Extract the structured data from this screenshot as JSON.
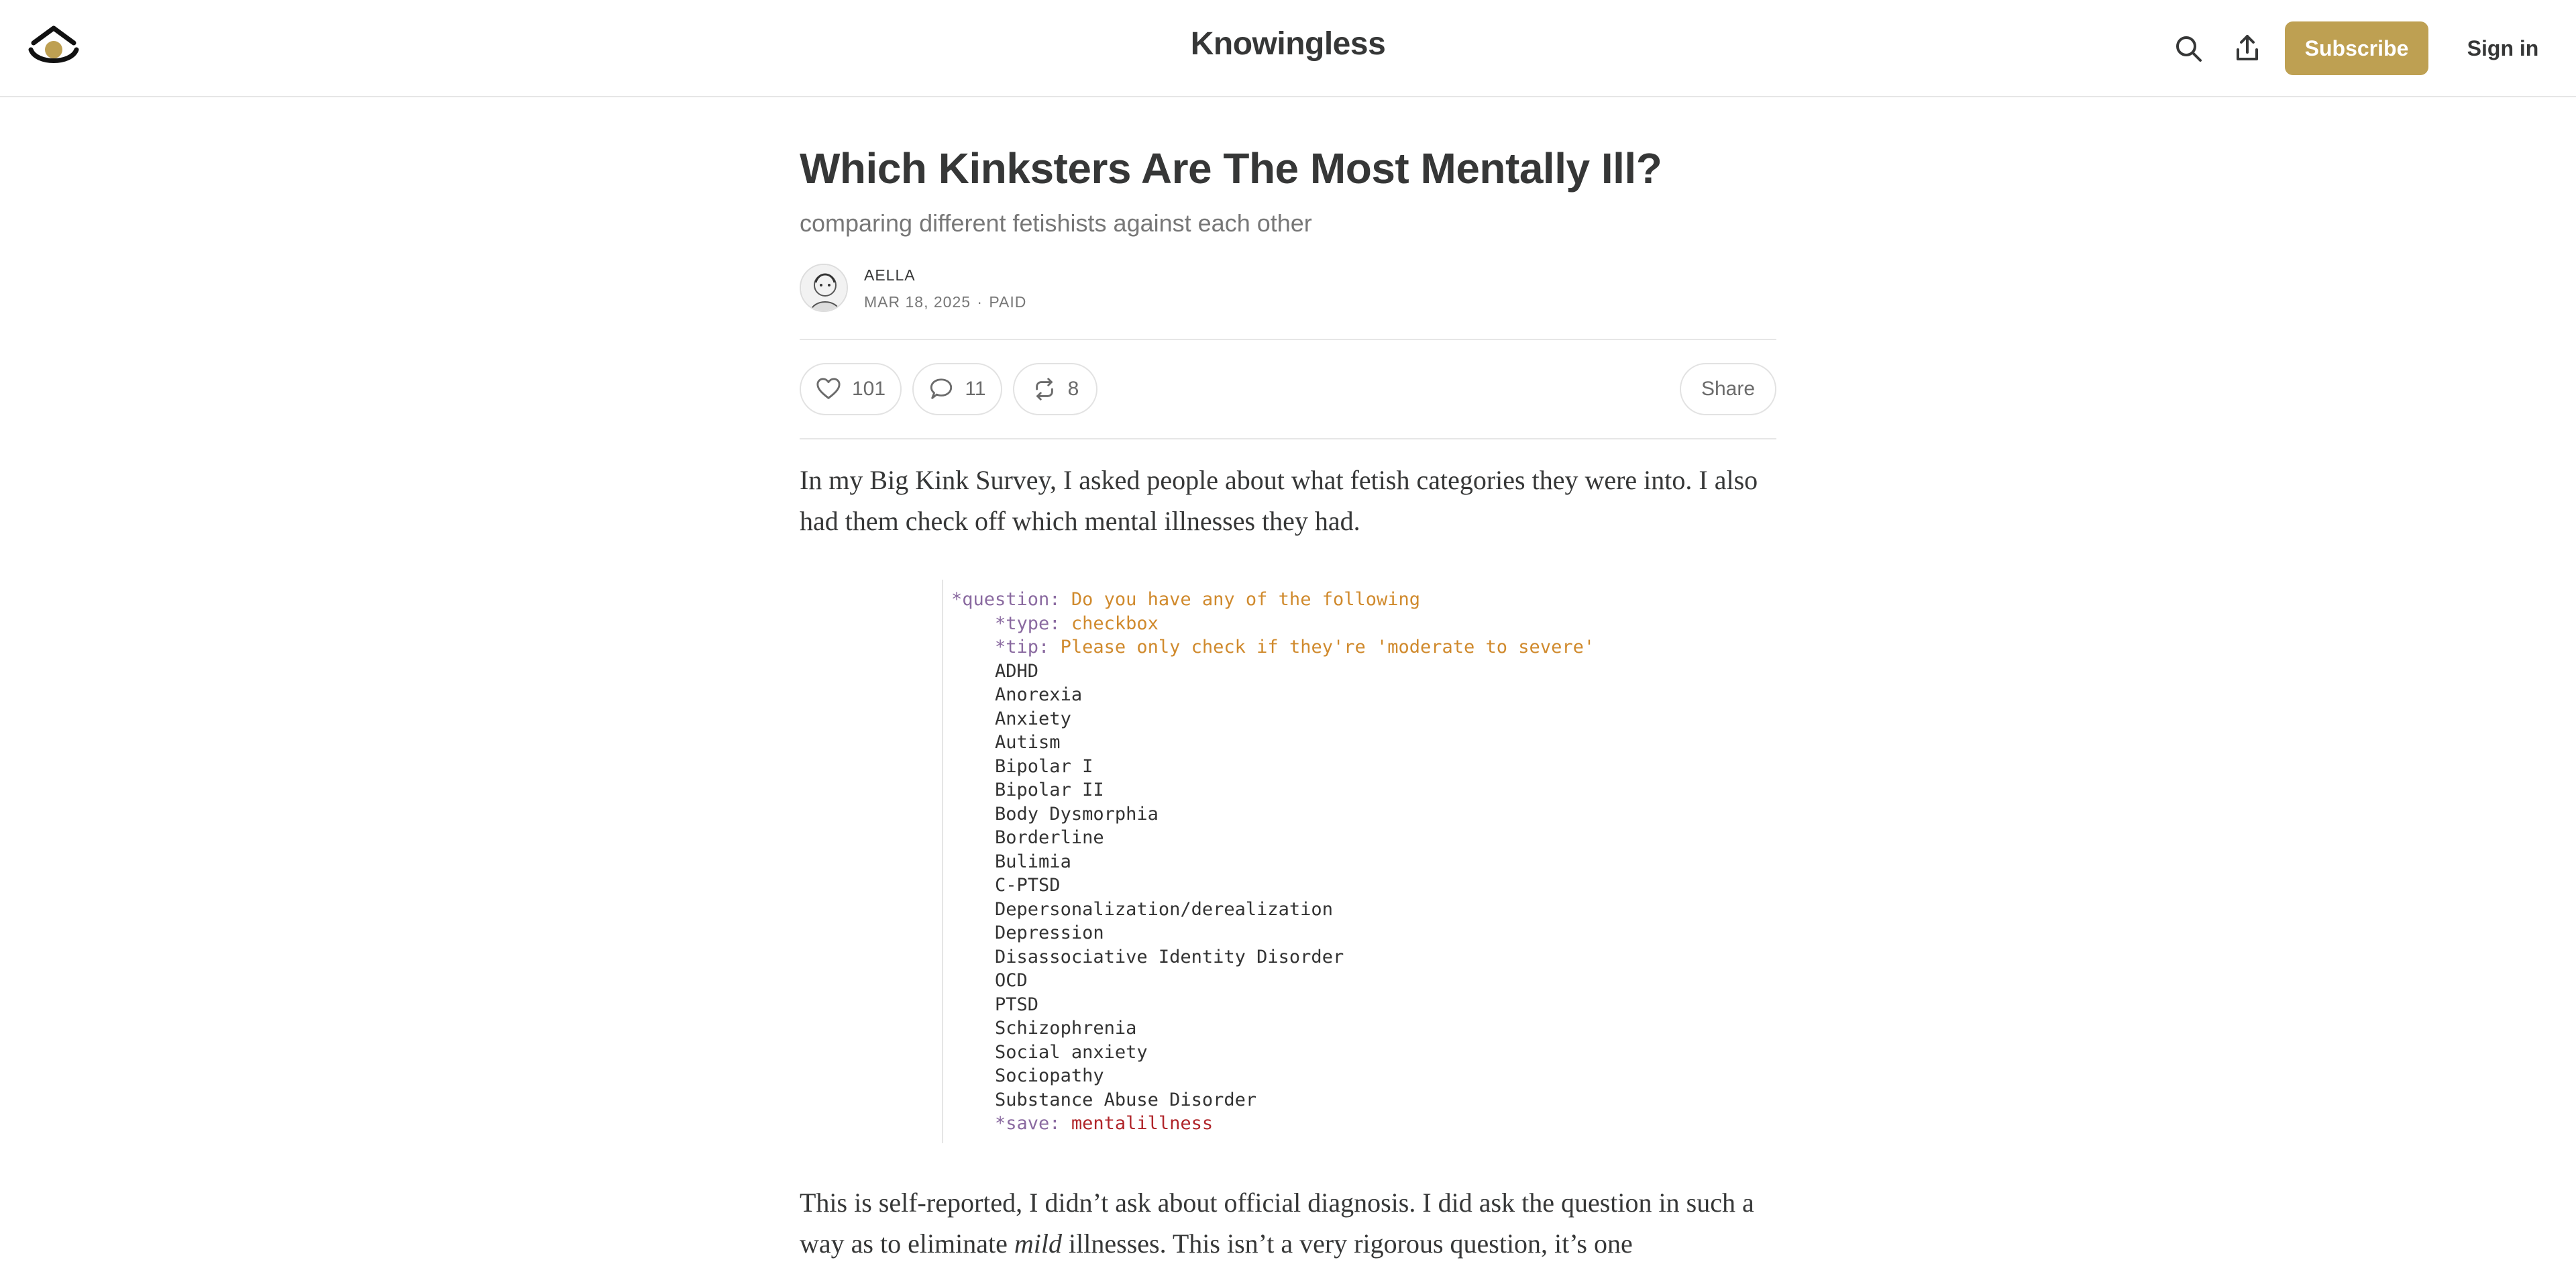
{
  "header": {
    "site_title": "Knowingless",
    "logo_icon": "eye-logo-icon",
    "search_icon": "search-icon",
    "share_icon": "share-upload-icon",
    "subscribe_label": "Subscribe",
    "signin_label": "Sign in",
    "accent_color": "#bea052"
  },
  "post": {
    "title": "Which Kinksters Are The Most Mentally Ill?",
    "subtitle": "comparing different fetishists against each other",
    "author": "AELLA",
    "date": "MAR 18, 2025",
    "separator": "∙",
    "access": "PAID"
  },
  "actions": {
    "likes": "101",
    "comments": "11",
    "restacks": "8",
    "share_label": "Share"
  },
  "body": {
    "paragraph_1": "In my Big Kink Survey, I asked people about what fetish categories they were into. I also had them check off which mental illnesses they had.",
    "paragraph_2_start": "This is self-reported, I didn’t ask about official diagnosis. I did ask the question in such a way as to eliminate ",
    "paragraph_2_em": "mild",
    "paragraph_2_end": " illnesses. This isn’t a very rigorous question, it’s one"
  },
  "code": {
    "question_key": "*question:",
    "question_value": "Do you have any of the following",
    "type_key": "*type:",
    "type_value": "checkbox",
    "tip_key": "*tip:",
    "tip_value": "Please only check if they're 'moderate to severe'",
    "options": [
      "ADHD",
      "Anorexia",
      "Anxiety",
      "Autism",
      "Bipolar I",
      "Bipolar II",
      "Body Dysmorphia",
      "Borderline",
      "Bulimia",
      "C-PTSD",
      "Depersonalization/derealization",
      "Depression",
      "Disassociative Identity Disorder",
      "OCD",
      "PTSD",
      "Schizophrenia",
      "Social anxiety",
      "Sociopathy",
      "Substance Abuse Disorder"
    ],
    "save_key": "*save:",
    "save_value": "mentalillness"
  }
}
